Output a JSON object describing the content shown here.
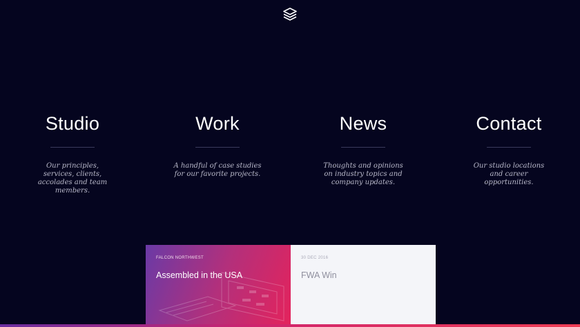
{
  "logo": {
    "icon": "layers-icon",
    "color": "#ffffff"
  },
  "nav": [
    {
      "title": "Studio",
      "description": "Our principles, services, clients, accolades and team members."
    },
    {
      "title": "Work",
      "description": "A handful of case studies for our favorite projects."
    },
    {
      "title": "News",
      "description": "Thoughts and opinions on industry topics and company updates."
    },
    {
      "title": "Contact",
      "description": "Our studio locations and career opportunities."
    }
  ],
  "cards": [
    {
      "label": "FALCON NORTHWEST",
      "headline": "Assembled in the USA"
    },
    {
      "label": "30 DEC 2016",
      "headline": "FWA Win"
    }
  ],
  "colors": {
    "background": "#05051f",
    "accent_gradient_start": "#6a3aa6",
    "accent_gradient_end": "#e4235c",
    "card_light": "#f4f5f9"
  }
}
